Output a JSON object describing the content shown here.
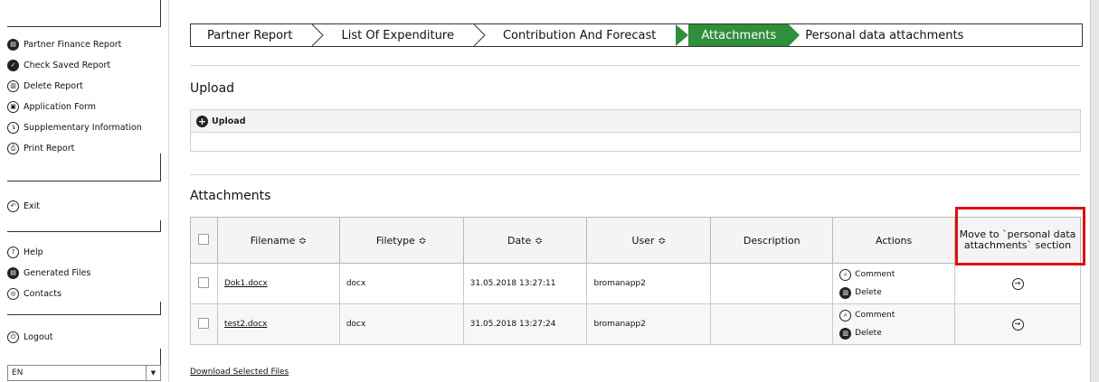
{
  "sidebar": {
    "menu1": [
      {
        "label": "Partner Finance Report",
        "icon": "report-icon"
      },
      {
        "label": "Check Saved Report",
        "icon": "check-icon"
      },
      {
        "label": "Delete Report",
        "icon": "trash-icon"
      },
      {
        "label": "Application Form",
        "icon": "form-icon"
      },
      {
        "label": "Supplementary Information",
        "icon": "info-icon"
      },
      {
        "label": "Print Report",
        "icon": "printer-icon"
      }
    ],
    "exit_label": "Exit",
    "menu2": [
      {
        "label": "Help",
        "icon": "help-icon"
      },
      {
        "label": "Generated Files",
        "icon": "files-icon"
      },
      {
        "label": "Contacts",
        "icon": "contacts-icon"
      }
    ],
    "logout_label": "Logout",
    "language": "EN"
  },
  "breadcrumb": {
    "steps": [
      "Partner Report",
      "List Of Expenditure",
      "Contribution And Forecast",
      "Attachments",
      "Personal data attachments"
    ],
    "active_index": 3,
    "active_color": "#2f8f3a"
  },
  "upload": {
    "title": "Upload",
    "button_label": "Upload"
  },
  "attachments": {
    "title": "Attachments",
    "columns": {
      "filename": "Filename ≎",
      "filetype": "Filetype ≎",
      "date": "Date ≎",
      "user": "User ≎",
      "description": "Description",
      "actions": "Actions",
      "move": "Move to `personal data attachments` section"
    },
    "rows": [
      {
        "filename": "Dok1.docx",
        "filetype": "docx",
        "date": "31.05.2018 13:27:11",
        "user": "bromanapp2",
        "description": "",
        "comment": "Comment",
        "delete": "Delete"
      },
      {
        "filename": "test2.docx",
        "filetype": "docx",
        "date": "31.05.2018 13:27:24",
        "user": "bromanapp2",
        "description": "",
        "comment": "Comment",
        "delete": "Delete"
      }
    ],
    "download_label": "Download Selected Files"
  },
  "colors": {
    "highlight": "#e01010",
    "active_step": "#2f8f3a"
  }
}
